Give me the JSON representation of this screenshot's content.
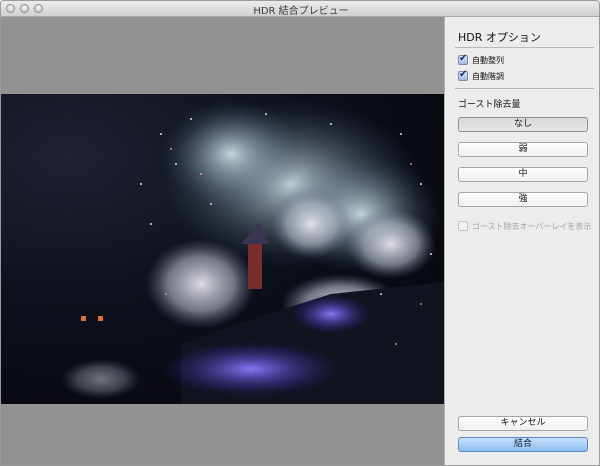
{
  "window": {
    "title": "HDR 結合プレビュー"
  },
  "options": {
    "heading": "HDR オプション",
    "auto_align": {
      "label": "自動整列",
      "checked": true
    },
    "auto_tone": {
      "label": "自動階調",
      "checked": true
    },
    "deghost_label": "ゴースト除去量",
    "deghost_buttons": [
      "なし",
      "弱",
      "中",
      "強"
    ],
    "deghost_selected": "なし",
    "overlay": {
      "label": "ゴースト除去オーバーレイを表示",
      "checked": false,
      "enabled": false
    }
  },
  "footer": {
    "cancel_label": "キャンセル",
    "merge_label": "結合"
  },
  "colors": {
    "preview_bg": "#929292",
    "primary_button": "#8ebcf1"
  }
}
